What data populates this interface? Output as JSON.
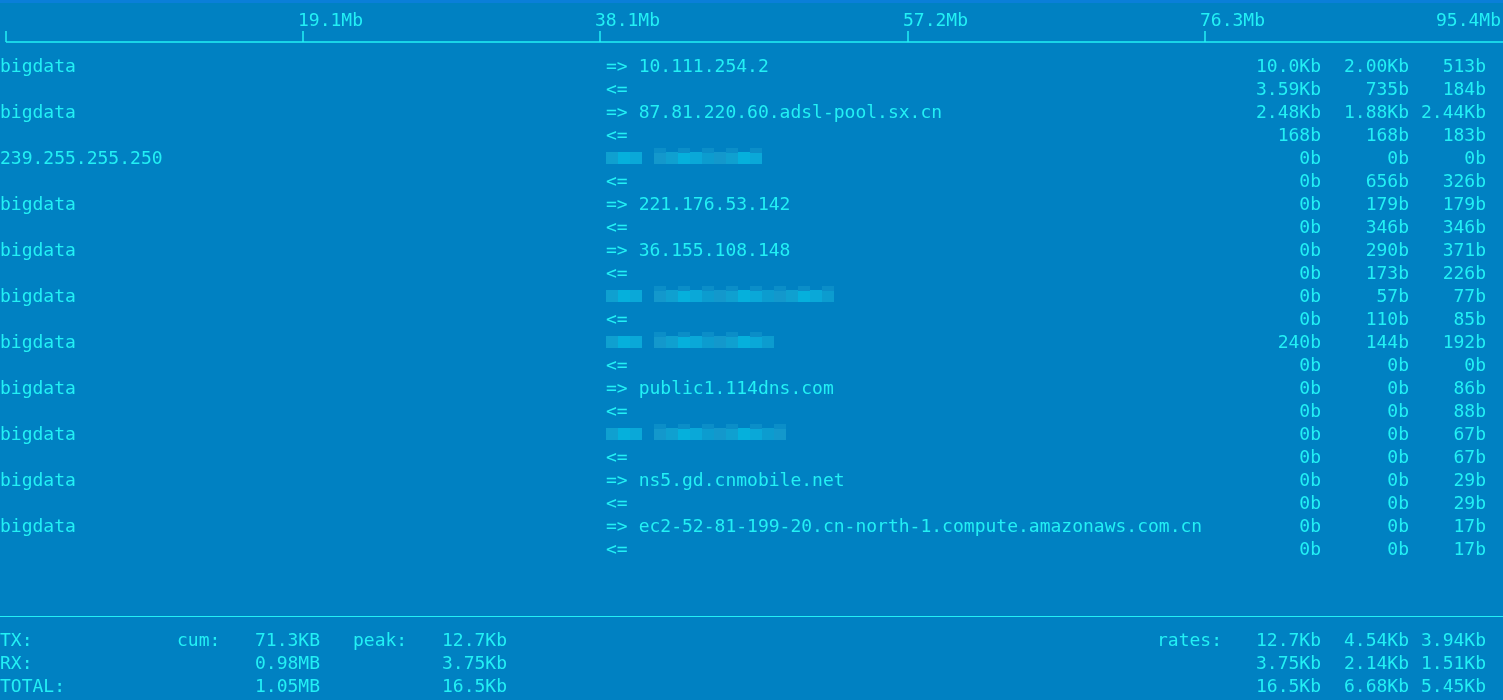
{
  "scale": {
    "labels": [
      "19.1Mb",
      "38.1Mb",
      "57.2Mb",
      "76.3Mb",
      "95.4Mb"
    ]
  },
  "connections": [
    {
      "host": "bigdata",
      "sent": {
        "direction": "=>",
        "remote": "10.111.254.2",
        "rates": [
          "10.0Kb",
          "2.00Kb",
          "513b"
        ]
      },
      "received": {
        "direction": "<=",
        "rates": [
          "3.59Kb",
          "735b",
          "184b"
        ]
      }
    },
    {
      "host": "bigdata",
      "sent": {
        "direction": "=>",
        "remote": "87.81.220.60.adsl-pool.sx.cn",
        "rates": [
          "2.48Kb",
          "1.88Kb",
          "2.44Kb"
        ]
      },
      "received": {
        "direction": "<=",
        "rates": [
          "168b",
          "168b",
          "183b"
        ]
      }
    },
    {
      "host": "239.255.255.250",
      "sent": {
        "redacted": true,
        "rates": [
          "0b",
          "0b",
          "0b"
        ]
      },
      "received": {
        "direction": "<=",
        "rates": [
          "0b",
          "656b",
          "326b"
        ]
      }
    },
    {
      "host": "bigdata",
      "sent": {
        "direction": "=>",
        "remote": "221.176.53.142",
        "rates": [
          "0b",
          "179b",
          "179b"
        ]
      },
      "received": {
        "direction": "<=",
        "rates": [
          "0b",
          "346b",
          "346b"
        ]
      }
    },
    {
      "host": "bigdata",
      "sent": {
        "direction": "=>",
        "remote": "36.155.108.148",
        "rates": [
          "0b",
          "290b",
          "371b"
        ]
      },
      "received": {
        "direction": "<=",
        "rates": [
          "0b",
          "173b",
          "226b"
        ]
      }
    },
    {
      "host": "bigdata",
      "sent": {
        "redacted": true,
        "rates": [
          "0b",
          "57b",
          "77b"
        ]
      },
      "received": {
        "direction": "<=",
        "rates": [
          "0b",
          "110b",
          "85b"
        ]
      }
    },
    {
      "host": "bigdata",
      "sent": {
        "redacted": true,
        "rates": [
          "240b",
          "144b",
          "192b"
        ]
      },
      "received": {
        "direction": "<=",
        "rates": [
          "0b",
          "0b",
          "0b"
        ]
      }
    },
    {
      "host": "bigdata",
      "sent": {
        "direction": "=>",
        "remote": "public1.114dns.com",
        "rates": [
          "0b",
          "0b",
          "86b"
        ]
      },
      "received": {
        "direction": "<=",
        "rates": [
          "0b",
          "0b",
          "88b"
        ]
      }
    },
    {
      "host": "bigdata",
      "sent": {
        "redacted": true,
        "rates": [
          "0b",
          "0b",
          "67b"
        ]
      },
      "received": {
        "direction": "<=",
        "rates": [
          "0b",
          "0b",
          "67b"
        ]
      }
    },
    {
      "host": "bigdata",
      "sent": {
        "direction": "=>",
        "remote": "ns5.gd.cnmobile.net",
        "rates": [
          "0b",
          "0b",
          "29b"
        ]
      },
      "received": {
        "direction": "<=",
        "rates": [
          "0b",
          "0b",
          "29b"
        ]
      }
    },
    {
      "host": "bigdata",
      "sent": {
        "direction": "=>",
        "remote": "ec2-52-81-199-20.cn-north-1.compute.amazonaws.com.cn",
        "rates": [
          "0b",
          "0b",
          "17b"
        ]
      },
      "received": {
        "direction": "<=",
        "rates": [
          "0b",
          "0b",
          "17b"
        ]
      }
    }
  ],
  "totals": [
    {
      "label": "TX:",
      "cum_label": "cum:",
      "cum": "71.3KB",
      "peak_label": "peak:",
      "peak": "12.7Kb",
      "rates_label": "rates:",
      "rates": [
        "12.7Kb",
        "4.54Kb",
        "3.94Kb"
      ]
    },
    {
      "label": "RX:",
      "cum": "0.98MB",
      "peak": "3.75Kb",
      "rates": [
        "3.75Kb",
        "2.14Kb",
        "1.51Kb"
      ]
    },
    {
      "label": "TOTAL:",
      "cum": "1.05MB",
      "peak": "16.5Kb",
      "rates": [
        "16.5Kb",
        "6.68Kb",
        "5.45Kb"
      ]
    }
  ]
}
